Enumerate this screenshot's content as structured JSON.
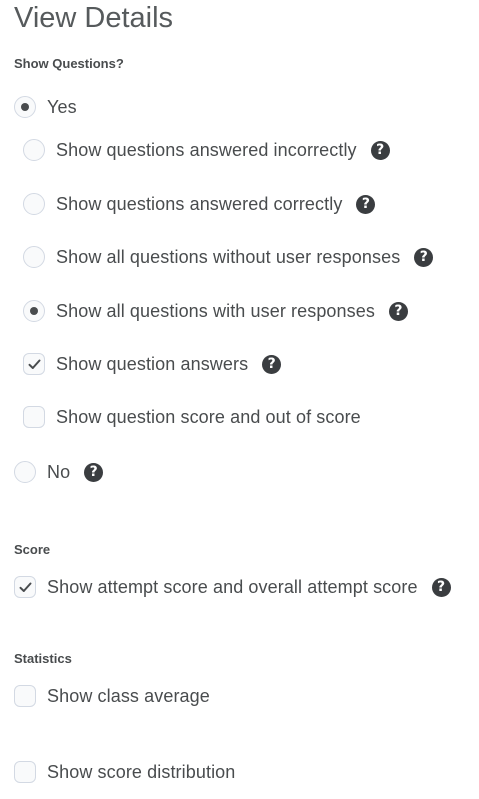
{
  "title": "View Details",
  "show_questions": {
    "label": "Show Questions?",
    "yes": {
      "label": "Yes",
      "selected": true
    },
    "options": [
      {
        "label": "Show questions answered incorrectly",
        "type": "radio",
        "checked": false,
        "help": true
      },
      {
        "label": "Show questions answered correctly",
        "type": "radio",
        "checked": false,
        "help": true
      },
      {
        "label": "Show all questions without user responses",
        "type": "radio",
        "checked": false,
        "help": true
      },
      {
        "label": "Show all questions with user responses",
        "type": "radio",
        "checked": true,
        "help": true
      },
      {
        "label": "Show question answers",
        "type": "checkbox",
        "checked": true,
        "help": true
      },
      {
        "label": "Show question score and out of score",
        "type": "checkbox",
        "checked": false,
        "help": false
      }
    ],
    "no": {
      "label": "No",
      "selected": false,
      "help": true
    }
  },
  "score": {
    "label": "Score",
    "attempt_score": {
      "label": "Show attempt score and overall attempt score",
      "checked": true,
      "help": true
    }
  },
  "statistics": {
    "label": "Statistics",
    "class_average": {
      "label": "Show class average",
      "checked": false
    },
    "score_distribution": {
      "label": "Show score distribution",
      "checked": false
    }
  },
  "icons": {
    "help_glyph": "?",
    "help_icon": "question-circle-icon",
    "check_icon": "checkmark-icon"
  },
  "colors": {
    "text": "#494c4e",
    "title": "#565a5c",
    "control_border": "#d3d9e3",
    "control_bg": "#f9fafb",
    "help_bg": "#3a3d40"
  }
}
